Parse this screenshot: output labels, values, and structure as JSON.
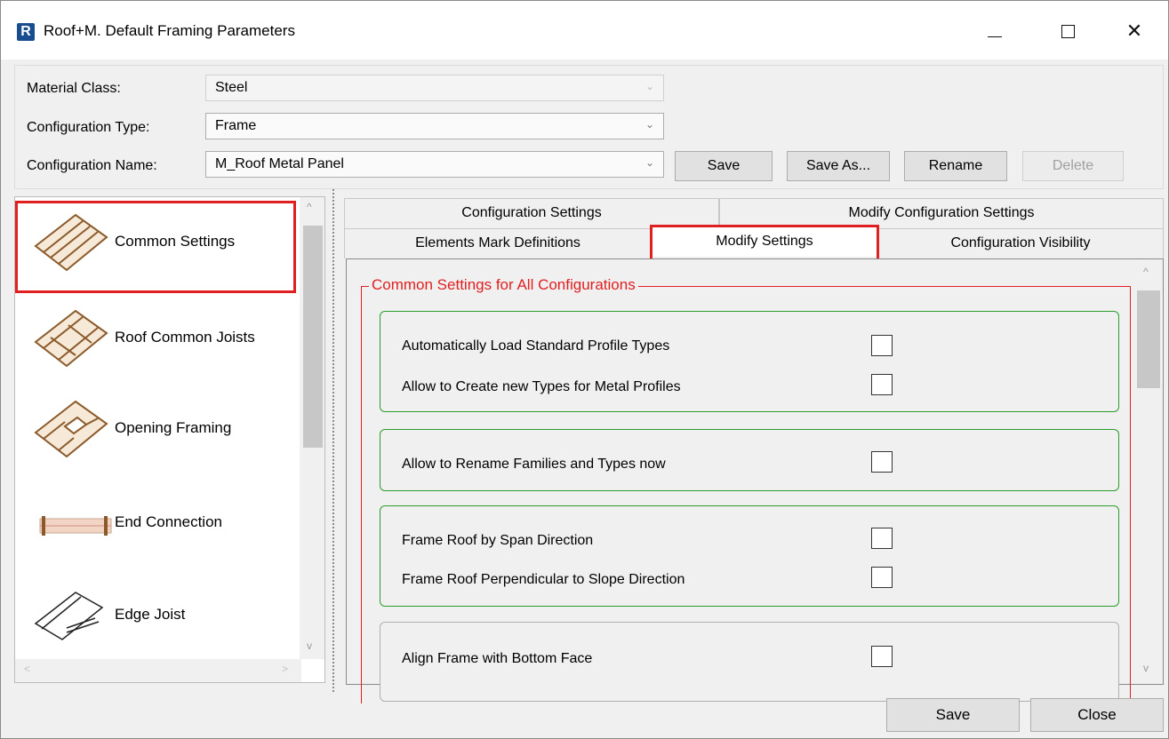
{
  "window": {
    "title": "Roof+M. Default Framing Parameters",
    "app_icon_letter": "R",
    "close_glyph": "✕"
  },
  "form": {
    "material_class": {
      "label": "Material Class:",
      "value": "Steel"
    },
    "configuration_type": {
      "label": "Configuration Type:",
      "value": "Frame"
    },
    "configuration_name": {
      "label": "Configuration Name:",
      "value": "M_Roof Metal Panel"
    },
    "caret_glyph": "⌄"
  },
  "config_buttons": {
    "save": "Save",
    "save_as": "Save As...",
    "rename": "Rename",
    "delete": "Delete"
  },
  "left_list": {
    "items": [
      {
        "label": "Common Settings",
        "icon": "roof-panel-icon",
        "selected": true
      },
      {
        "label": "Roof Common Joists",
        "icon": "roof-joists-icon"
      },
      {
        "label": "Opening Framing",
        "icon": "opening-framing-icon"
      },
      {
        "label": "End Connection",
        "icon": "end-connection-icon"
      },
      {
        "label": "Edge Joist",
        "icon": "edge-joist-icon"
      }
    ],
    "scroll_glyphs": {
      "up": "^",
      "down": "v",
      "left": "<",
      "right": ">"
    }
  },
  "tabs": {
    "row1": [
      "Configuration Settings",
      "Modify Configuration Settings"
    ],
    "row2": [
      "Elements Mark Definitions",
      "Modify Settings",
      "Configuration Visibility"
    ],
    "selected": "Modify Settings"
  },
  "content": {
    "group_title": "Common Settings for All Configurations",
    "options": [
      {
        "label": "Automatically Load Standard Profile Types",
        "checked": false
      },
      {
        "label": "Allow to Create new Types for Metal Profiles",
        "checked": false
      },
      {
        "label": "Allow to Rename Families and Types now",
        "checked": false
      },
      {
        "label": "Frame Roof by Span Direction",
        "checked": false
      },
      {
        "label": "Frame Roof Perpendicular to Slope Direction",
        "checked": false
      },
      {
        "label": "Align Frame with Bottom Face",
        "checked": false
      }
    ]
  },
  "footer": {
    "save": "Save",
    "close": "Close"
  },
  "colors": {
    "highlight": "#e02020",
    "group_border_green": "#2a9d2a",
    "wood": "#8b5a2b"
  }
}
